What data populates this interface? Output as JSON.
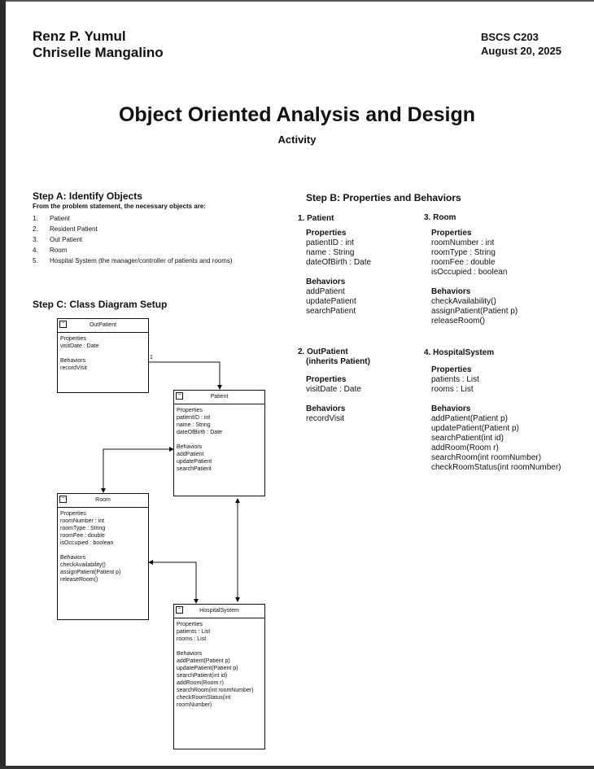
{
  "header": {
    "authors": [
      "Renz P. Yumul",
      "Chriselle Mangalino"
    ],
    "section": "BSCS C203",
    "date": "August 20, 2025"
  },
  "title": "Object Oriented Analysis and Design",
  "subtitle": "Activity",
  "step_a": {
    "heading": "Step A: Identify Objects",
    "intro": "From the problem statement, the necessary objects are:",
    "items": [
      {
        "num": "1.",
        "text": "Patient"
      },
      {
        "num": "2.",
        "text": "Resident Patient"
      },
      {
        "num": "3.",
        "text": "Out Patient"
      },
      {
        "num": "4.",
        "text": "Room"
      },
      {
        "num": "5.",
        "text": "Hospital System (the manager/controller of patients and rooms)"
      }
    ]
  },
  "step_b": {
    "heading": "Step B: Properties and Behaviors",
    "patient": {
      "title": "1. Patient",
      "properties_label": "Properties",
      "properties": [
        "patientID : int",
        "name : String",
        "dateOfBirth : Date"
      ],
      "behaviors_label": "Behaviors",
      "behaviors": [
        "addPatient",
        "updatePatient",
        "searchPatient"
      ]
    },
    "outpatient": {
      "title": "2. OutPatient",
      "title2": "(inherits Patient)",
      "properties_label": "Properties",
      "properties": [
        "visitDate : Date"
      ],
      "behaviors_label": "Behaviors",
      "behaviors": [
        "recordVisit"
      ]
    },
    "room": {
      "title": "3. Room",
      "properties_label": "Properties",
      "properties": [
        "roomNumber : int",
        "roomType : String",
        "roomFee : double",
        "isOccupied : boolean"
      ],
      "behaviors_label": "Behaviors",
      "behaviors": [
        "checkAvailability()",
        "assignPatient(Patient p)",
        "releaseRoom()"
      ]
    },
    "hospital": {
      "title": "4. HospitalSystem",
      "properties_label": "Properties",
      "properties": [
        "patients : List",
        "rooms : List"
      ],
      "behaviors_label": "Behaviors",
      "behaviors": [
        "addPatient(Patient p)",
        "updatePatient(Patient p)",
        "searchPatient(int id)",
        "addRoom(Room r)",
        "searchRoom(int roomNumber)",
        "checkRoomStatus(int roomNumber)"
      ]
    }
  },
  "step_c": {
    "heading": "Step C: Class Diagram Setup",
    "multiplicity": "1",
    "classes": {
      "outpatient": {
        "name": "OutPatient",
        "lines": [
          "Properties",
          "visitDate : Date",
          "",
          "Behaviors",
          "recordVisit"
        ]
      },
      "patient": {
        "name": "Patient",
        "lines": [
          "Properties",
          "patientID : int",
          "name : String",
          "dateOfBirth : Date",
          "",
          "Behaviors",
          "addPatient",
          "updatePatient",
          "searchPatient"
        ]
      },
      "room": {
        "name": "Room",
        "lines": [
          "Properties",
          "roomNumber : int",
          "roomType : String",
          "roomFee : double",
          "isOccupied : boolean",
          "",
          "Behaviors",
          "checkAvailability()",
          "assignPatient(Patient p)",
          "releaseRoom()"
        ]
      },
      "hospital": {
        "name": "HospitalSystem",
        "lines": [
          "Properties",
          "patients : List",
          "rooms : List",
          "",
          "Behaviors",
          "addPatient(Patient p)",
          "updatePatient(Patient p)",
          "searchPatient(int id)",
          "addRoom(Room r)",
          "searchRoom(int roomNumber)",
          "checkRoomStatus(int",
          "roomNumber)"
        ]
      }
    }
  }
}
